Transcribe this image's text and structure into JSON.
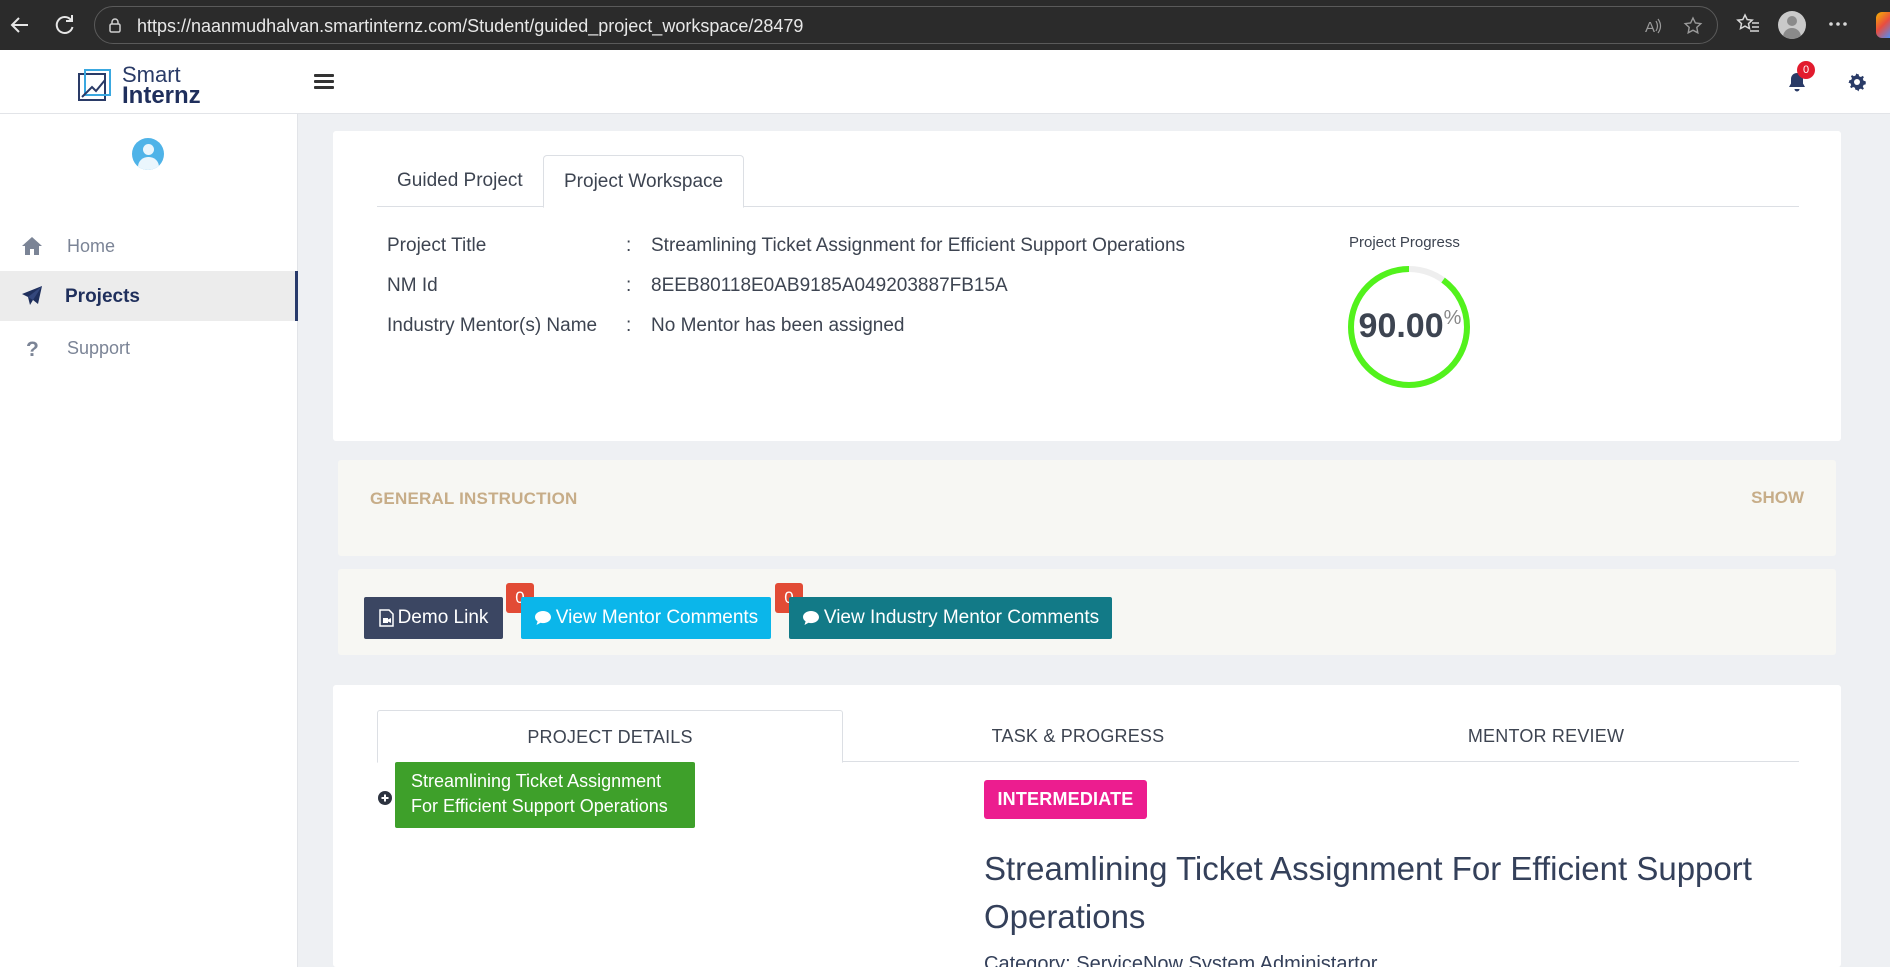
{
  "browser": {
    "url": "https://naanmudhalvan.smartinternz.com/Student/guided_project_workspace/28479"
  },
  "header": {
    "logo_line1": "Smart",
    "logo_line2": "Internz",
    "notification_count": "0"
  },
  "sidebar": {
    "items": [
      {
        "label": "Home",
        "icon": "home-icon"
      },
      {
        "label": "Projects",
        "icon": "paper-plane-icon"
      },
      {
        "label": "Support",
        "icon": "question-icon"
      }
    ]
  },
  "info_card": {
    "tabs": [
      {
        "label": "Guided Project"
      },
      {
        "label": "Project Workspace"
      }
    ],
    "rows": [
      {
        "label": "Project Title",
        "colon": ":",
        "value": "Streamlining Ticket Assignment for Efficient Support Operations"
      },
      {
        "label": "NM Id",
        "colon": ":",
        "value": "8EEB80118E0AB9185A049203887FB15A"
      },
      {
        "label": "Industry Mentor(s) Name",
        "colon": ":",
        "value": "No Mentor has been assigned"
      }
    ],
    "progress_label": "Project Progress",
    "progress_value": "90.00",
    "progress_unit": "%",
    "progress_fraction": 0.9,
    "progress_color": "#52f21c"
  },
  "general": {
    "title": "GENERAL INSTRUCTION",
    "toggle": "SHOW"
  },
  "actions": {
    "demo_label": "Demo Link",
    "mentor_label": "View Mentor Comments",
    "mentor_count": "0",
    "industry_label": "View Industry Mentor Comments",
    "industry_count": "0"
  },
  "details": {
    "tabs": [
      {
        "label": "PROJECT DETAILS"
      },
      {
        "label": "TASK & PROGRESS"
      },
      {
        "label": "MENTOR REVIEW"
      }
    ],
    "tree_item": "Streamlining Ticket Assignment For Efficient Support Operations",
    "level": "INTERMEDIATE",
    "title": "Streamlining Ticket Assignment For Efficient Support Operations",
    "category": "Category: ServiceNow System Administartor"
  }
}
